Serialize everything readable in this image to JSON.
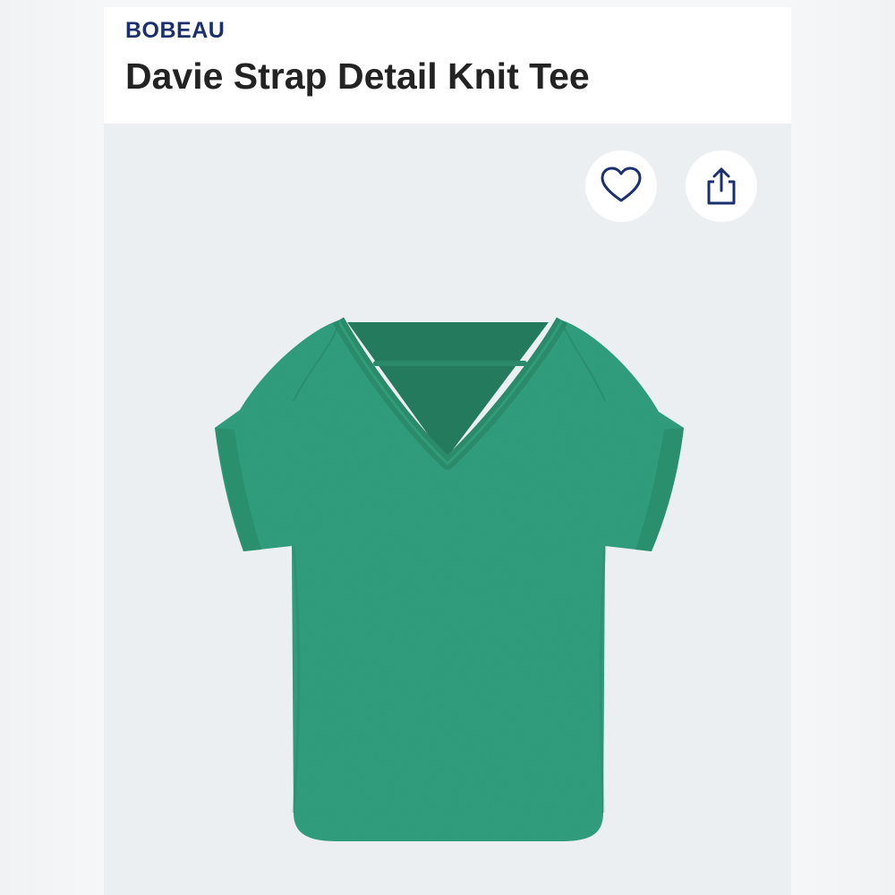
{
  "product": {
    "brand": "BOBEAU",
    "title": "Davie Strap Detail Knit Tee",
    "image_alt": "Green v-neck knit tee with back strap detail",
    "garment_color": "#2f9b78"
  },
  "actions": {
    "favorite_icon": "heart-icon",
    "share_icon": "share-icon",
    "icon_color": "#1c2f6e"
  }
}
